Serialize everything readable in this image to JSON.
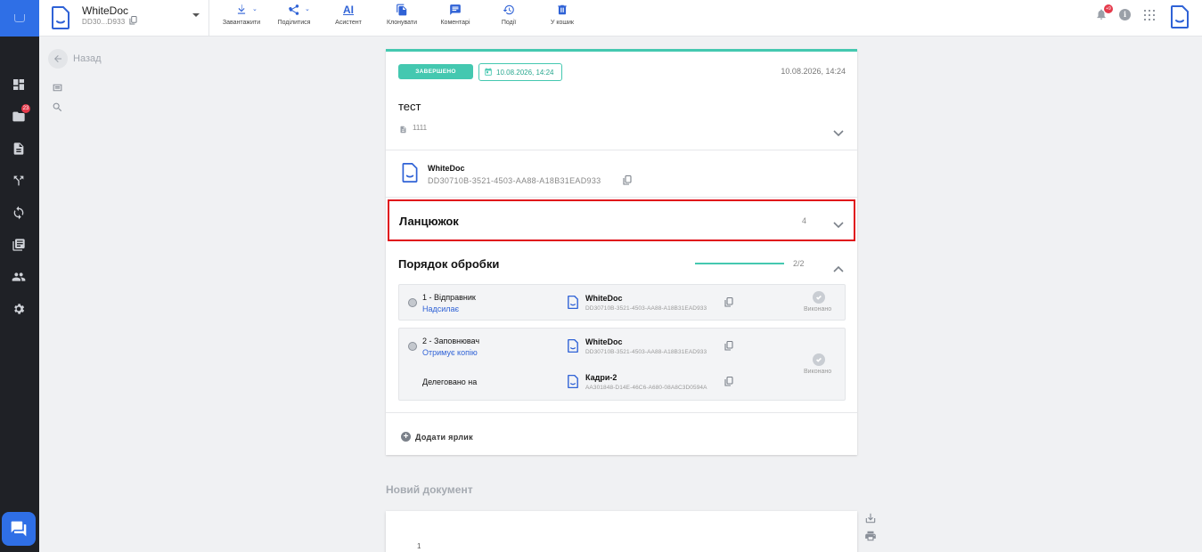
{
  "app": {
    "doc_name": "WhiteDoc",
    "doc_short_id": "DD30...D933"
  },
  "toolbar": [
    {
      "label": "Завантажити",
      "icon": "download-icon",
      "has_caret": true
    },
    {
      "label": "Поділитися",
      "icon": "share-icon",
      "has_caret": true
    },
    {
      "label": "Асистент",
      "icon": "ai-assistant-icon",
      "has_caret": false
    },
    {
      "label": "Клонувати",
      "icon": "clone-icon",
      "has_caret": false
    },
    {
      "label": "Коментарі",
      "icon": "comment-icon",
      "has_caret": false
    },
    {
      "label": "Події",
      "icon": "history-icon",
      "has_caret": false
    },
    {
      "label": "У кошик",
      "icon": "trash-icon",
      "has_caret": false
    }
  ],
  "notifications": {
    "count": "+9"
  },
  "sidebar": {
    "folder_badge": "23"
  },
  "back": {
    "label": "Назад"
  },
  "document": {
    "status": "ЗАВЕРШЕНО",
    "deadline": "10.08.2026, 14:24",
    "date": "10.08.2026, 14:24",
    "title": "тест",
    "number": "1111",
    "org_name": "WhiteDoc",
    "org_uuid": "DD30710B-3521-4503-AA88-A18B31EAD933"
  },
  "chain": {
    "title": "Ланцюжок",
    "count": "4"
  },
  "processing": {
    "title": "Порядок обробки",
    "progress_text": "2/2",
    "progress_fraction": 1.0,
    "steps": [
      {
        "role": "1 - Відправник",
        "action": "Надсилає",
        "org_name": "WhiteDoc",
        "org_uuid": "DD30710B-3521-4503-AA88-A18B31EAD933",
        "status": "Виконано"
      },
      {
        "role": "2 - Заповнювач",
        "action": "Отримує копію",
        "org_name": "WhiteDoc",
        "org_uuid": "DD30710B-3521-4503-AA88-A18B31EAD933",
        "delegated_label": "Делеговано на",
        "delegate_name": "Кадри-2",
        "delegate_uuid": "AA301848-D14E-46C6-A680-08A8C3D0594A",
        "status": "Виконано"
      }
    ]
  },
  "add_label": "Додати ярлик",
  "new_document": {
    "title": "Новий документ",
    "page_number": "1"
  },
  "colors": {
    "accent": "#44c8b0",
    "primary": "#2f62d6",
    "highlight": "#e0101a",
    "sidebar": "#1f2126"
  }
}
